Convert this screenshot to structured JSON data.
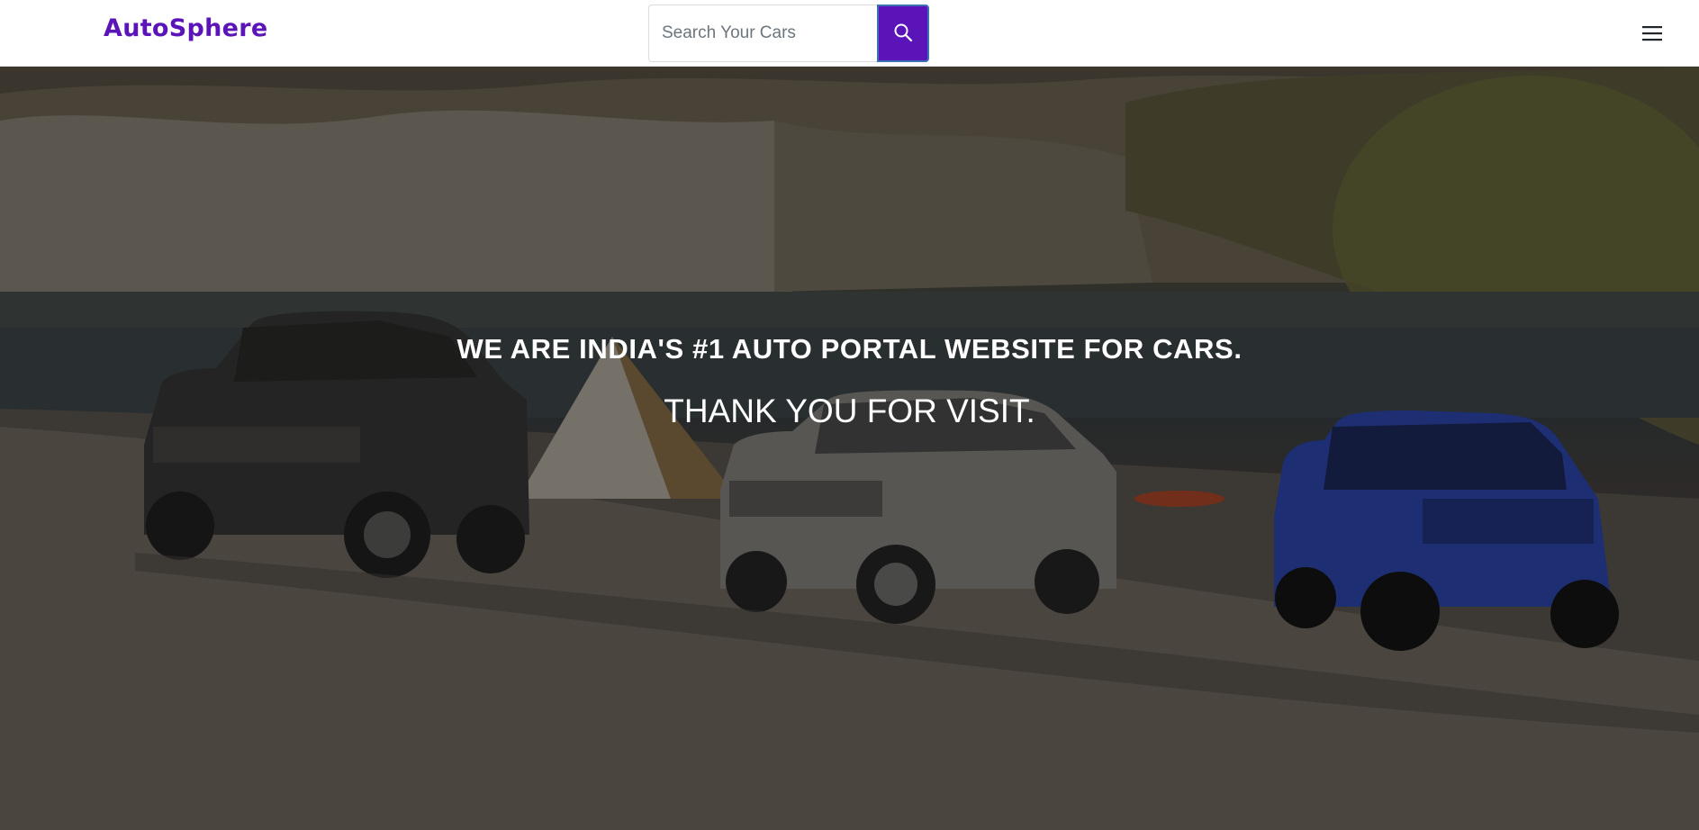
{
  "navbar": {
    "brand": "AutoSphere",
    "search": {
      "placeholder": "Search Your Cars",
      "button_icon": "search-icon"
    },
    "menu_icon": "hamburger-menu-icon"
  },
  "hero": {
    "headline": "WE ARE INDIA'S #1 AUTO PORTAL WEBSITE FOR CARS.",
    "subline": "THANK YOU FOR VISIT.",
    "background_image": "three SUVs parked on a lakeside beach with a tent, cliffs and trees"
  },
  "colors": {
    "brand": "#5b14b8",
    "search_button": "#5b14b8",
    "hero_text": "#ffffff"
  }
}
